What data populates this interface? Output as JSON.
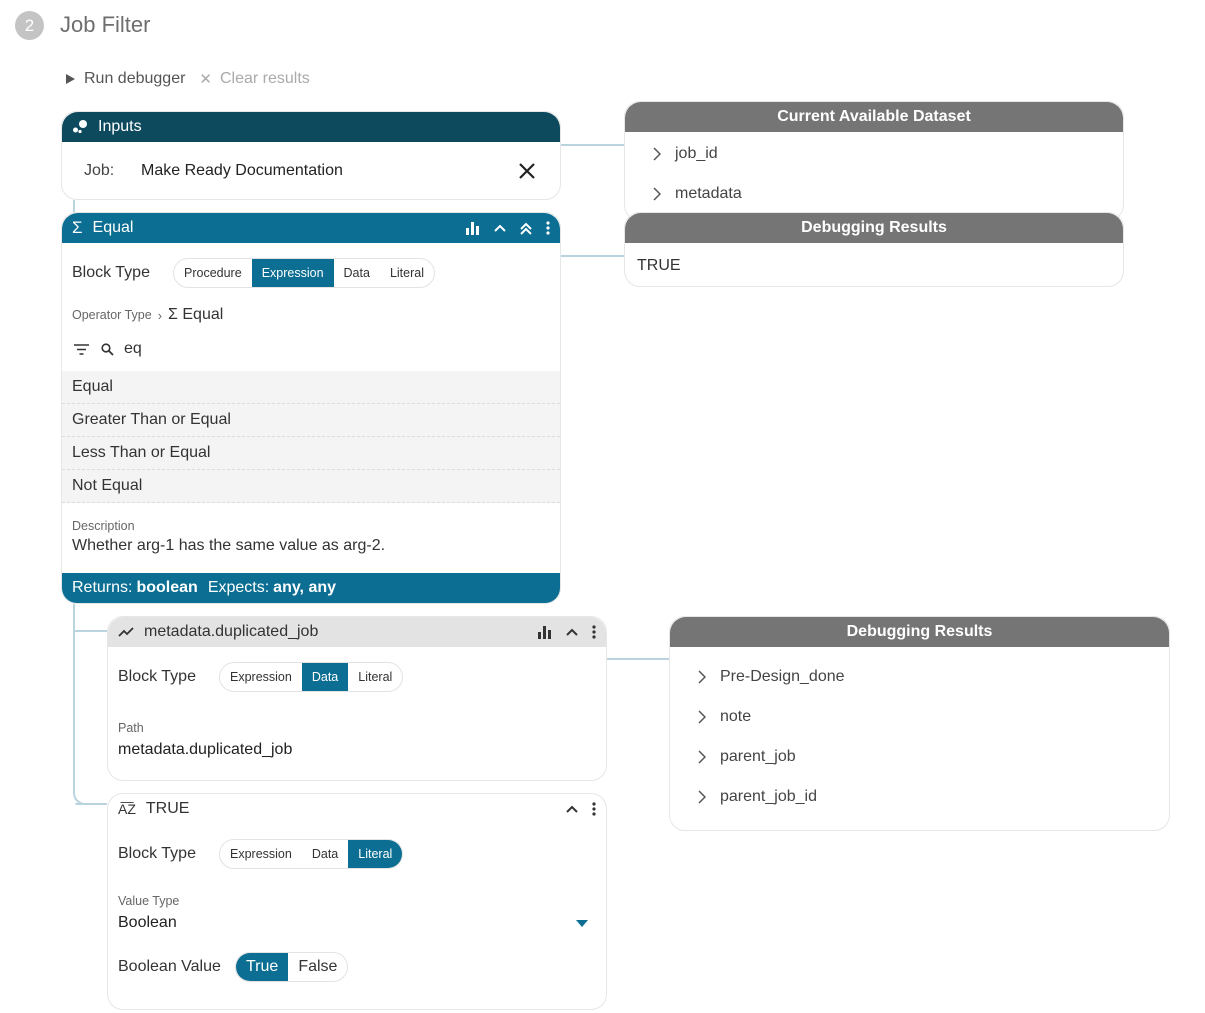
{
  "header": {
    "step_number": "2",
    "title": "Job Filter",
    "run_label": "Run debugger",
    "clear_label": "Clear results"
  },
  "inputs": {
    "title": "Inputs",
    "job_label": "Job:",
    "job_value": "Make Ready Documentation"
  },
  "equal_block": {
    "title": "Equal",
    "block_type_label": "Block Type",
    "block_types": [
      "Procedure",
      "Expression",
      "Data",
      "Literal"
    ],
    "active_block_type": "Expression",
    "operator_type_label": "Operator Type",
    "operator_type_value": "Σ Equal",
    "search_value": "eq",
    "options": [
      "Equal",
      "Greater Than or Equal",
      "Less Than or Equal",
      "Not Equal"
    ],
    "description_label": "Description",
    "description_value": "Whether arg-1 has the same value as arg-2.",
    "returns_label": "Returns:",
    "returns_value": "boolean",
    "expects_label": "Expects:",
    "expects_value": "any, any"
  },
  "metadata_block": {
    "title": "metadata.duplicated_job",
    "block_type_label": "Block Type",
    "block_types": [
      "Expression",
      "Data",
      "Literal"
    ],
    "active_block_type": "Data",
    "path_label": "Path",
    "path_value": "metadata.duplicated_job"
  },
  "true_block": {
    "title": "TRUE",
    "block_type_label": "Block Type",
    "block_types": [
      "Expression",
      "Data",
      "Literal"
    ],
    "active_block_type": "Literal",
    "value_type_label": "Value Type",
    "value_type_value": "Boolean",
    "boolean_label": "Boolean Value",
    "boolean_options": [
      "True",
      "False"
    ],
    "active_boolean": "True"
  },
  "dataset_panel": {
    "title": "Current Available Dataset",
    "items": [
      "job_id",
      "metadata"
    ]
  },
  "debug_panel_1": {
    "title": "Debugging Results",
    "value": "TRUE"
  },
  "debug_panel_2": {
    "title": "Debugging Results",
    "items": [
      "Pre-Design_done",
      "note",
      "parent_job",
      "parent_job_id"
    ]
  },
  "colors": {
    "teal": "#0b6e92",
    "dark_teal": "#0e4a5e",
    "panel_gray": "#757575",
    "connector": "#b9d4de"
  }
}
